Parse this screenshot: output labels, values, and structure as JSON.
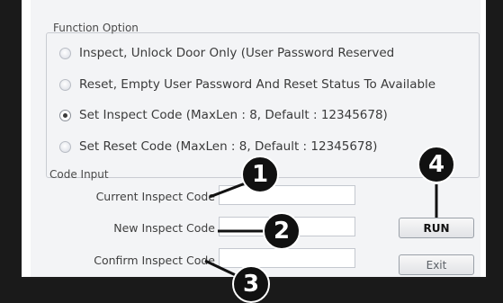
{
  "function_option": {
    "title": "Function Option",
    "options": [
      {
        "label": "Inspect, Unlock Door Only (User Password Reserved",
        "selected": false
      },
      {
        "label": "Reset, Empty User Password And Reset Status To Available",
        "selected": false
      },
      {
        "label": "Set Inspect Code (MaxLen : 8, Default : 12345678)",
        "selected": true
      },
      {
        "label": "Set Reset Code (MaxLen : 8, Default : 12345678)",
        "selected": false
      }
    ]
  },
  "code_input": {
    "title": "Code Input",
    "current_inspect_code": {
      "label": "Current Inspect Code",
      "value": ""
    },
    "new_inspect_code": {
      "label": "New Inspect Code",
      "value": ""
    },
    "confirm_inspect_code": {
      "label": "Confirm Inspect Code",
      "value": ""
    }
  },
  "buttons": {
    "run": "RUN",
    "exit": "Exit"
  },
  "callouts": [
    "1",
    "2",
    "3",
    "4"
  ],
  "colors": {
    "badge": "#111111",
    "panel": "#f3f4f6",
    "frame": "#1c1c1c"
  }
}
